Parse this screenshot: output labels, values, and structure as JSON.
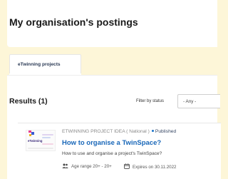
{
  "header": {
    "title": "My organisation's postings"
  },
  "tabs": [
    {
      "label": "eTwinning projects",
      "active": true
    }
  ],
  "results": {
    "heading": "Results (1)",
    "filter_label": "Filter by status",
    "filter_value": "- Any -"
  },
  "items": [
    {
      "category": "ETWINNING PROJECT IDEA ( National )",
      "status": "Published",
      "title": "How to organise a TwinSpace?",
      "description": "How to use and organise a project's TwinSpace?",
      "age_range": "Age range 20+ - 20+",
      "expires": "Expires on 30.11.2022",
      "thumbnail_text": "eTwinning",
      "icons": {
        "age": "people-icon",
        "expires": "calendar-icon"
      }
    }
  ],
  "colors": {
    "background": "#fdf6d8",
    "link": "#1766b8",
    "status_dot": "#1a73c9"
  }
}
